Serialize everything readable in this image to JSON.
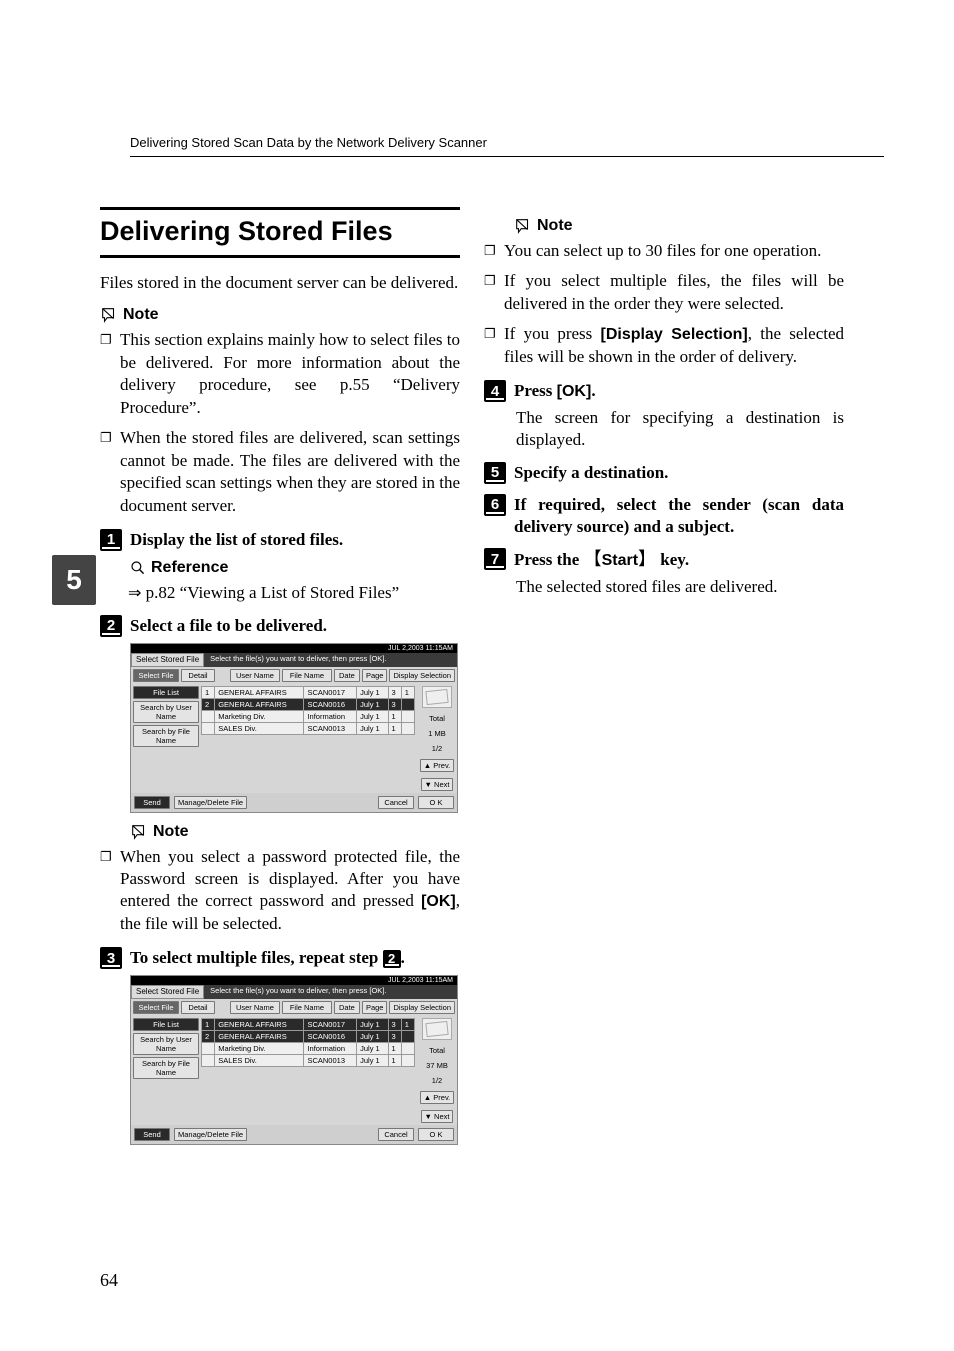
{
  "running_header": "Delivering Stored Scan Data by the Network Delivery Scanner",
  "chapter_tab": "5",
  "page_number": "64",
  "section_title": "Delivering Stored Files",
  "intro": "Files stored in the document server can be delivered.",
  "notes1_label": "Note",
  "notes1": [
    "This section explains mainly how to select files to be delivered. For more information about the delivery procedure, see p.55 “Delivery Procedure”.",
    "When the stored files are delivered, scan settings cannot be made. The files are delivered with the specified scan settings when they are stored in the document server."
  ],
  "steps": {
    "s1": {
      "num": "1",
      "text": "Display the list of stored files."
    },
    "s2": {
      "num": "2",
      "text": "Select a file to be delivered."
    },
    "s3": {
      "num": "3",
      "text_pre": "To select multiple files, repeat step ",
      "ref_step": "2",
      "text_post": "."
    },
    "s4": {
      "num": "4",
      "text_pre": "Press ",
      "ui_label": "[OK]",
      "text_post": "."
    },
    "s5": {
      "num": "5",
      "text": "Specify a destination."
    },
    "s6": {
      "num": "6",
      "text": "If required, select the sender (scan data delivery source) and a subject."
    },
    "s7": {
      "num": "7",
      "text_pre": "Press the ",
      "hardkey": "Start",
      "text_post": " key."
    }
  },
  "reference_label": "Reference",
  "reference_arrow": "⇒",
  "reference_text": " p.82 “Viewing a List of Stored Files”",
  "notes2_label": "Note",
  "notes2": [
    "When you select a password protected file, the Password screen is displayed. After you have entered the correct password and pressed [OK], the file will be selected."
  ],
  "notes2_ok_label": "[OK]",
  "notes3_label": "Note",
  "notes3": [
    "You can select up to 30 files for one operation.",
    "If you select multiple files, the files will be delivered in the order they were selected.",
    "If you press [Display Selection], the selected files will be shown in the order of delivery."
  ],
  "notes3_disp_label": "[Display Selection]",
  "step4_body": "The screen for specifying a destination is displayed.",
  "step7_body": "The selected stored files are delivered.",
  "shot": {
    "timestamp": "JUL   2,2003 11:15AM",
    "top_tab": "Select Stored File",
    "top_msg": "Select the file(s) you want to deliver, then press [OK].",
    "btn_select_file": "Select File",
    "btn_detail": "Detail",
    "side": {
      "file_list": "File List",
      "search_user": "Search by User Name",
      "search_file": "Search by File Name",
      "send": "Send"
    },
    "header": {
      "user": "User Name",
      "file": "File Name",
      "date": "Date",
      "page": "Page",
      "disp_sel": "Display Selection"
    },
    "rows": [
      {
        "idx": "1",
        "user": "GENERAL AFFAIRS",
        "file": "SCAN0017",
        "date": "July  1",
        "page": "3",
        "extra": "1"
      },
      {
        "idx": "2",
        "user": "GENERAL AFFAIRS",
        "file": "SCAN0016",
        "date": "July  1",
        "page": "3",
        "extra": ""
      },
      {
        "idx": "",
        "user": "Marketing Div.",
        "file": "Information",
        "date": "July  1",
        "page": "1",
        "extra": ""
      },
      {
        "idx": "",
        "user": "SALES Div.",
        "file": "SCAN0013",
        "date": "July  1",
        "page": "1",
        "extra": ""
      }
    ],
    "page_indicator": "1/2",
    "prev": "▲ Prev.",
    "next": "▼ Next",
    "manage": "Manage/Delete File",
    "cancel": "Cancel",
    "ok": "O K",
    "total_label": "Total",
    "total_a": "1 MB",
    "total_b": "37 MB"
  }
}
